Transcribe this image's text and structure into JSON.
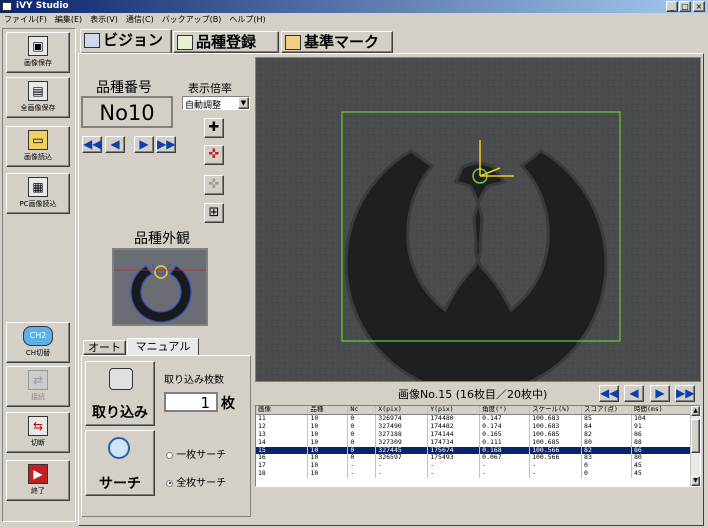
{
  "window": {
    "title": "iVY Studio",
    "min": "_",
    "max": "□",
    "close": "×"
  },
  "menu": [
    "ファイル(F)",
    "編集(E)",
    "表示(V)",
    "通信(C)",
    "バックアップ(B)",
    "ヘルプ(H)"
  ],
  "sidebar": {
    "top": [
      {
        "label": "画像保存",
        "icon": "floppy-icon"
      },
      {
        "label": "全画像保存",
        "icon": "multi-image-icon"
      },
      {
        "label": "画像読込",
        "icon": "folder-icon"
      },
      {
        "label": "PC画像読込",
        "icon": "pc-camera-icon"
      }
    ],
    "bottom": [
      {
        "label": "CH切替",
        "icon": "ch-switch-icon",
        "glyph": "CH2"
      },
      {
        "label": "接続",
        "icon": "connect-icon"
      },
      {
        "label": "切断",
        "icon": "disconnect-icon"
      },
      {
        "label": "終了",
        "icon": "exit-icon"
      }
    ]
  },
  "tabs": [
    "ビジョン",
    "品種登録",
    "基準マーク"
  ],
  "product": {
    "number_label": "品種番号",
    "number_value": "No10",
    "zoom_label": "表示倍率",
    "zoom_value": "自動調整",
    "appearance_label": "品種外観"
  },
  "mode_tabs": {
    "auto": "オート",
    "manual": "マニュアル"
  },
  "capture": {
    "button_label": "取り込み",
    "count_label": "取り込み枚数",
    "count_value": "1",
    "count_unit": "枚",
    "search_label": "サーチ",
    "radio_single": "一枚サーチ",
    "radio_all": "全枚サーチ",
    "radio_selected": "all"
  },
  "image_info": "画像No.15 (16枚目／20枚中)",
  "results": {
    "columns": [
      "画像",
      "品種",
      "Nc",
      "X(pix)",
      "Y(pix)",
      "角度(°)",
      "スケール(%)",
      "スコア(点)",
      "時間(ms)"
    ],
    "rows": [
      [
        "11",
        "10",
        "0",
        "326974",
        "174480",
        "0.147",
        "100.683",
        "85",
        "104"
      ],
      [
        "12",
        "10",
        "0",
        "327490",
        "174482",
        "0.174",
        "100.683",
        "84",
        "91"
      ],
      [
        "13",
        "10",
        "0",
        "327188",
        "174144",
        "0.165",
        "100.685",
        "82",
        "86"
      ],
      [
        "14",
        "10",
        "0",
        "327309",
        "174734",
        "0.111",
        "100.685",
        "80",
        "88"
      ],
      [
        "15",
        "10",
        "0",
        "327445",
        "175674",
        "0.168",
        "100.566",
        "82",
        "86"
      ],
      [
        "16",
        "10",
        "0",
        "326597",
        "175493",
        "0.067",
        "100.566",
        "83",
        "80"
      ],
      [
        "17",
        "10",
        "-",
        "-",
        "-",
        "-",
        "-",
        "0",
        "45"
      ],
      [
        "18",
        "10",
        "-",
        "-",
        "-",
        "-",
        "-",
        "0",
        "45"
      ]
    ],
    "selected_index": 4
  }
}
